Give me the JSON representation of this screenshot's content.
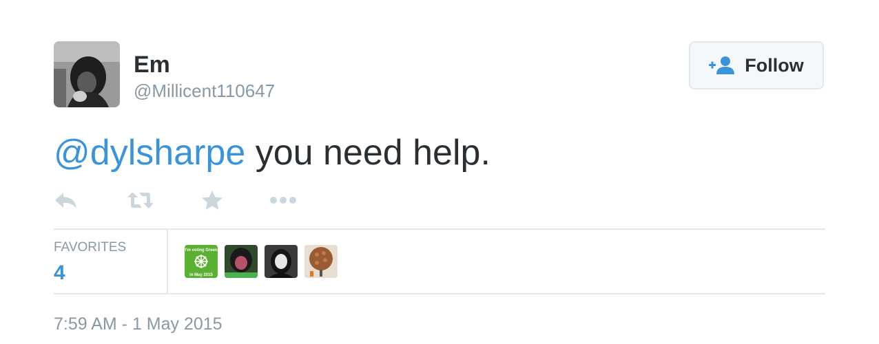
{
  "user": {
    "display_name": "Em",
    "screen_name": "@Millicent110647"
  },
  "follow_button": {
    "label": "Follow",
    "icon": "follow-person-plus-icon"
  },
  "tweet": {
    "mention": "@dylsharpe",
    "text": " you need help."
  },
  "actions": [
    {
      "name": "reply",
      "icon": "reply-icon"
    },
    {
      "name": "retweet",
      "icon": "retweet-icon"
    },
    {
      "name": "favorite",
      "icon": "star-icon"
    },
    {
      "name": "more",
      "icon": "more-dots-icon"
    }
  ],
  "stats": {
    "favorites_label": "FAVORITES",
    "favorites_count": "4"
  },
  "favoriter_avatar_1": {
    "badge_line1": "I'm voting Green",
    "badge_line2": "in May 2015"
  },
  "timestamp": "7:59 AM - 1 May 2015",
  "colors": {
    "text": "#292f33",
    "muted": "#8899a6",
    "link": "#3b94d9",
    "border": "#e1e8ed",
    "action_icon": "#ccd6dd",
    "green_badge": "#5ab030"
  }
}
